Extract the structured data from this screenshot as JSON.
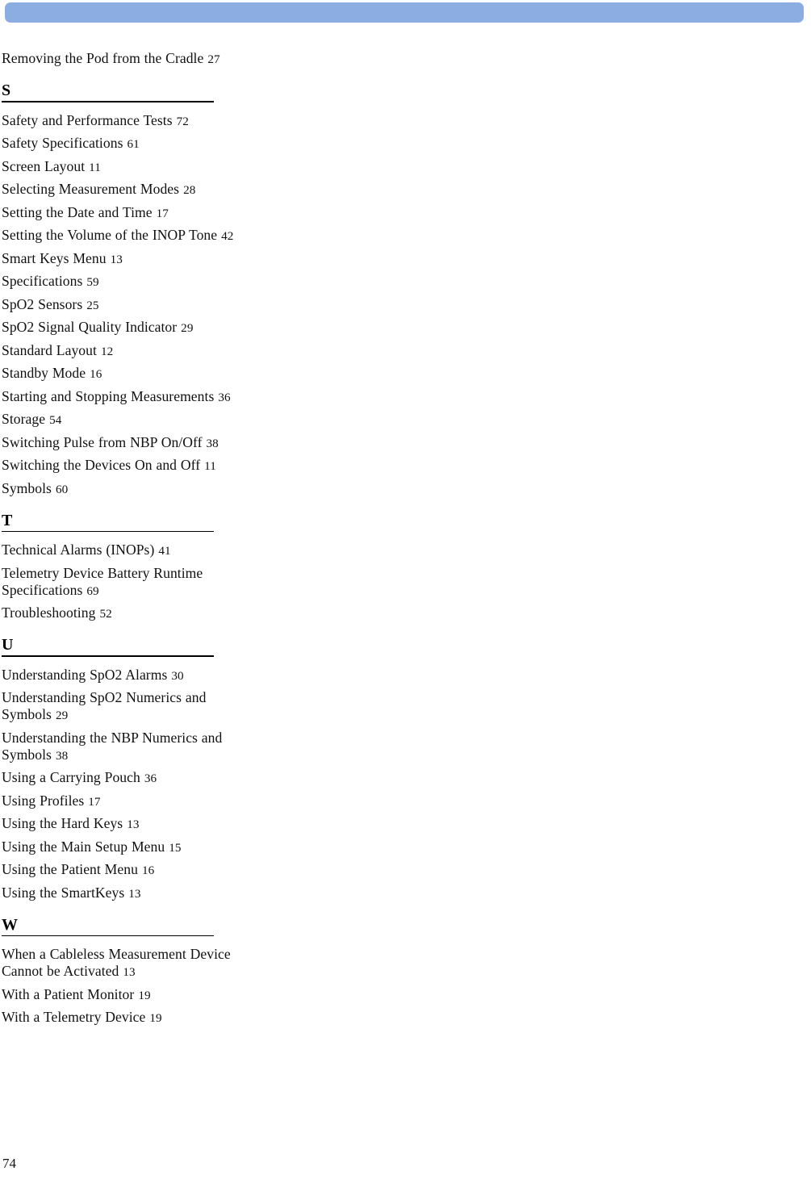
{
  "page": {
    "folio": "74",
    "accent_color": "#8BADE2",
    "text_color": "#111111"
  },
  "header": {
    "bar_label": "decorative-header-bar"
  },
  "index": {
    "blocks": [
      {
        "type": "entries",
        "entries": [
          {
            "title": "Removing the Pod from the Cradle",
            "page": "27"
          }
        ]
      },
      {
        "type": "section",
        "letter": "S",
        "entries": [
          {
            "title": "Safety and Performance Tests",
            "page": "72"
          },
          {
            "title": "Safety Specifications",
            "page": "61"
          },
          {
            "title": "Screen Layout",
            "page": "11"
          },
          {
            "title": "Selecting Measurement Modes",
            "page": "28"
          },
          {
            "title": "Setting the Date and Time",
            "page": "17"
          },
          {
            "title": "Setting the Volume of the INOP Tone",
            "page": "42"
          },
          {
            "title": "Smart Keys Menu",
            "page": "13"
          },
          {
            "title": "Specifications",
            "page": "59"
          },
          {
            "title": "SpO2 Sensors",
            "page": "25"
          },
          {
            "title": "SpO2 Signal Quality Indicator",
            "page": "29"
          },
          {
            "title": "Standard Layout",
            "page": "12"
          },
          {
            "title": "Standby Mode",
            "page": "16"
          },
          {
            "title": "Starting and Stopping Measurements",
            "page": "36"
          },
          {
            "title": "Storage",
            "page": "54"
          },
          {
            "title": "Switching Pulse from NBP On/Off",
            "page": "38"
          },
          {
            "title": "Switching the Devices On and Off",
            "page": "11"
          },
          {
            "title": "Symbols",
            "page": "60"
          }
        ]
      },
      {
        "type": "section",
        "letter": "T",
        "entries": [
          {
            "title": "Technical Alarms (INOPs)",
            "page": "41"
          },
          {
            "title": "Telemetry Device Battery Runtime Specifications",
            "page": "69"
          },
          {
            "title": "Troubleshooting",
            "page": "52"
          }
        ]
      },
      {
        "type": "section",
        "letter": "U",
        "entries": [
          {
            "title": "Understanding SpO2 Alarms",
            "page": "30"
          },
          {
            "title": "Understanding SpO2 Numerics and Symbols",
            "page": "29"
          },
          {
            "title": "Understanding the NBP Numerics and Symbols",
            "page": "38"
          },
          {
            "title": "Using a Carrying Pouch",
            "page": "36"
          },
          {
            "title": "Using Profiles",
            "page": "17"
          },
          {
            "title": "Using the Hard Keys",
            "page": "13"
          },
          {
            "title": "Using the Main Setup Menu",
            "page": "15"
          },
          {
            "title": "Using the Patient Menu",
            "page": "16"
          },
          {
            "title": "Using the SmartKeys",
            "page": "13"
          }
        ]
      },
      {
        "type": "section",
        "letter": "W",
        "entries": [
          {
            "title": "When a Cableless Measurement Device Cannot be Activated",
            "page": "13"
          },
          {
            "title": "With a Patient Monitor",
            "page": "19"
          },
          {
            "title": "With a Telemetry Device",
            "page": "19"
          }
        ]
      }
    ]
  }
}
